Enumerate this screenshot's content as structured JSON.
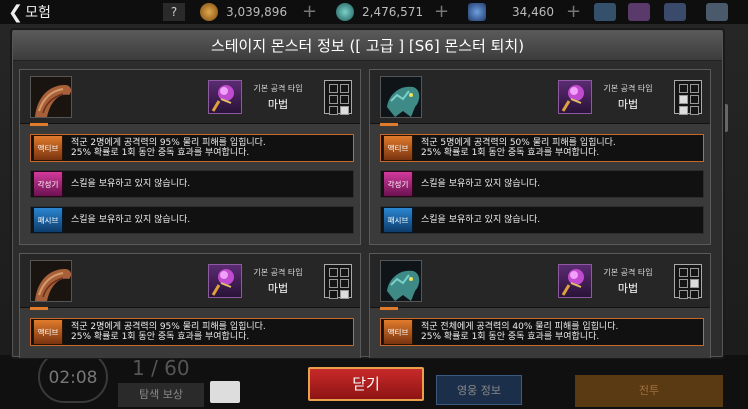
{
  "topbar": {
    "back_label": "모험",
    "question_label": "?",
    "gold": "3,039,896",
    "crystal": "2,476,571",
    "stamina": "34,460",
    "plus": "+"
  },
  "dialog": {
    "title": "스테이지 몬스터 정보 ([ 고급 ] [S6] 몬스터 퇴치)",
    "close_label": "닫기"
  },
  "monsters": [
    {
      "portrait": "worm",
      "attack_type_label": "기본 공격 타입",
      "attack_type_value": "마법",
      "grid": [
        0,
        0,
        0,
        0,
        0,
        1
      ],
      "skills": [
        {
          "tag": "액티브",
          "text": "적군 2명에게 공격력의 95% 물리 피해를 입힙니다.\n25% 확률로 1회 동안 중독 효과를 부여합니다."
        },
        {
          "tag": "각성기",
          "text": "스킬을 보유하고 있지 않습니다."
        },
        {
          "tag": "패시브",
          "text": "스킬을 보유하고 있지 않습니다."
        }
      ]
    },
    {
      "portrait": "beast",
      "attack_type_label": "기본 공격 타입",
      "attack_type_value": "마법",
      "grid": [
        0,
        0,
        1,
        0,
        1,
        0
      ],
      "skills": [
        {
          "tag": "액티브",
          "text": "적군 5명에게 공격력의 50% 물리 피해를 입힙니다.\n25% 확률로 1회 동안 중독 효과를 부여합니다."
        },
        {
          "tag": "각성기",
          "text": "스킬을 보유하고 있지 않습니다."
        },
        {
          "tag": "패시브",
          "text": "스킬을 보유하고 있지 않습니다."
        }
      ]
    },
    {
      "portrait": "worm",
      "attack_type_label": "기본 공격 타입",
      "attack_type_value": "마법",
      "grid": [
        0,
        0,
        0,
        0,
        0,
        1
      ],
      "skills": [
        {
          "tag": "액티브",
          "text": "적군 2명에게 공격력의 95% 물리 피해를 입힙니다.\n25% 확률로 1회 동안 중독 효과를 부여합니다."
        }
      ]
    },
    {
      "portrait": "beast",
      "attack_type_label": "기본 공격 타입",
      "attack_type_value": "마법",
      "grid": [
        0,
        0,
        0,
        1,
        0,
        0
      ],
      "skills": [
        {
          "tag": "액티브",
          "text": "적군 전체에게 공격력의 40% 물리 피해를 입힙니다.\n25% 확률로 1회 동안 중독 효과를 부여합니다."
        }
      ]
    }
  ],
  "background": {
    "timer": "02:08",
    "count": "1 / 60",
    "explore_reward": "탐색 보상",
    "hero_info": "영웅 정보",
    "battle": "전투"
  },
  "colors": {
    "active_tag": "#e07b2c",
    "awaken_tag": "#d23a9c",
    "passive_tag": "#2a86d1",
    "close_button": "#b01f1f"
  }
}
